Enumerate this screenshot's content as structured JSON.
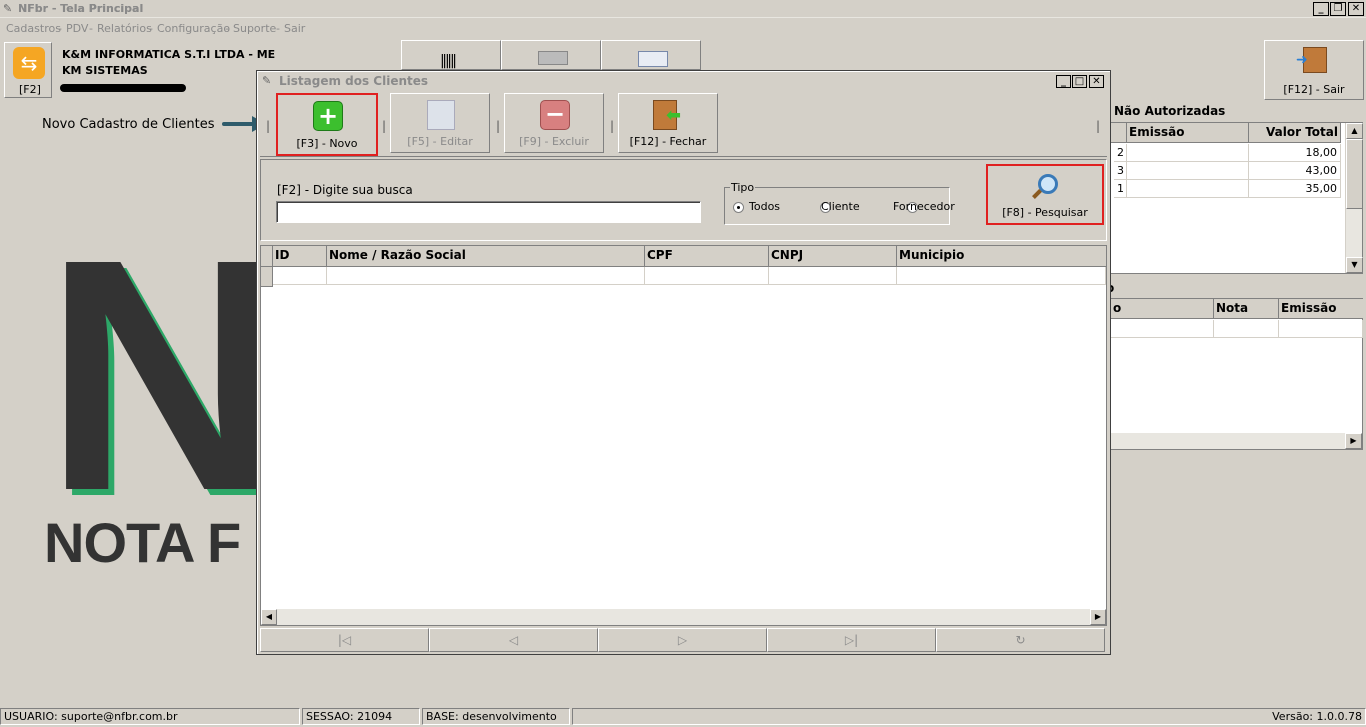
{
  "window": {
    "title": "NFbr - Tela Principal"
  },
  "menu": [
    "Cadastros",
    "-",
    "PDV",
    "-",
    "Relatórios",
    "-",
    "Configuração",
    "-",
    "Suporte",
    "-",
    "Sair"
  ],
  "header": {
    "sidebar_key": "[F2]",
    "company_line1": "K&M INFORMATICA S.T.I LTDA - ME",
    "company_line2": "KM SISTEMAS",
    "exit_label": "[F12] - Sair"
  },
  "logo": {
    "letter": "N",
    "text": "NOTA F"
  },
  "annotation": "Novo Cadastro de Clientes",
  "right_panel": {
    "title": "Não Autorizadas",
    "columns": [
      "Emissão",
      "Valor Total"
    ],
    "rows": [
      {
        "id": "2",
        "emissao": "",
        "valor": "18,00"
      },
      {
        "id": "3",
        "emissao": "",
        "valor": "43,00"
      },
      {
        "id": "1",
        "emissao": "",
        "valor": "35,00"
      }
    ],
    "lower_columns": [
      "o",
      "Nota",
      "Emissão"
    ]
  },
  "dialog": {
    "title": "Listagem dos Clientes",
    "toolbar": {
      "novo": "[F3] - Novo",
      "editar": "[F5] - Editar",
      "excluir": "[F9] - Excluir",
      "fechar": "[F12] - Fechar"
    },
    "search": {
      "label": "[F2] - Digite sua busca",
      "value": ""
    },
    "tipo": {
      "label": "Tipo",
      "options": [
        "Todos",
        "Cliente",
        "Fornecedor"
      ],
      "selected": "Todos"
    },
    "pesquisar": "[F8] - Pesquisar",
    "columns": [
      "ID",
      "Nome / Razão Social",
      "CPF",
      "CNPJ",
      "Municipio"
    ]
  },
  "status": {
    "usuario": "USUARIO: suporte@nfbr.com.br",
    "sessao": "SESSAO: 21094",
    "base": "BASE: desenvolvimento",
    "versao": "Versão: 1.0.0.78"
  },
  "colors": {
    "accent_green": "#2da868",
    "highlight_red": "#e02020",
    "logo_dark": "#333333"
  }
}
